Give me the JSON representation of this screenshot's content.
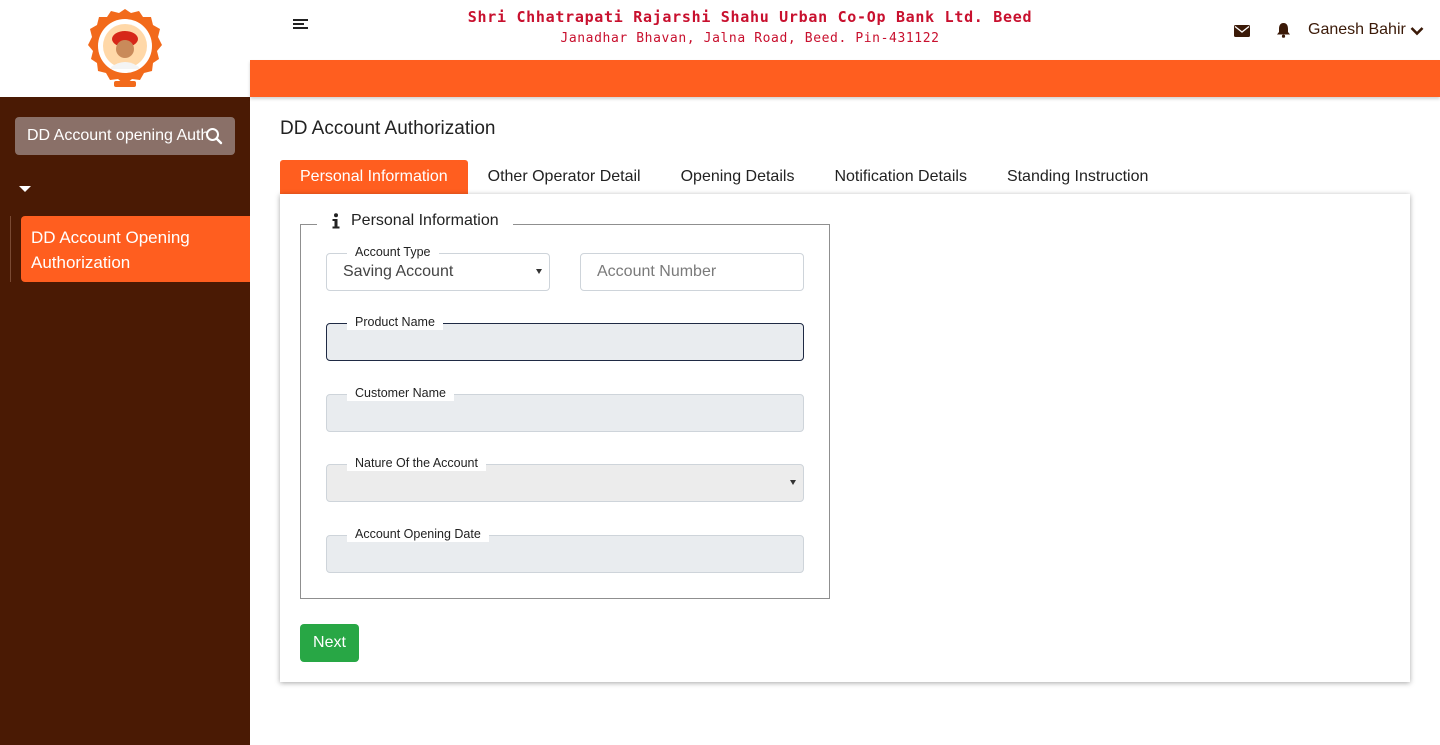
{
  "header": {
    "bank_title": "Shri Chhatrapati Rajarshi Shahu Urban Co-Op Bank Ltd. Beed",
    "bank_address": "Janadhar Bhavan, Jalna Road, Beed. Pin-431122",
    "user_name": "Ganesh Bahir"
  },
  "sidebar": {
    "search_value": "DD Account opening Authorization",
    "items": [
      {
        "label": "DD Account Opening Authorization",
        "active": true
      }
    ]
  },
  "main": {
    "page_title": "DD Account Authorization",
    "tabs": [
      {
        "label": "Personal Information",
        "active": true
      },
      {
        "label": "Other Operator Detail",
        "active": false
      },
      {
        "label": "Opening Details",
        "active": false
      },
      {
        "label": "Notification Details",
        "active": false
      },
      {
        "label": "Standing Instruction",
        "active": false
      }
    ],
    "section_title": "Personal Information",
    "form": {
      "account_type_label": "Account Type",
      "account_type_value": "Saving Account",
      "account_number_placeholder": "Account Number",
      "product_name_label": "Product Name",
      "product_name_value": "",
      "customer_name_label": "Customer Name",
      "customer_name_value": "",
      "nature_label": "Nature Of the Account",
      "nature_value": "",
      "opening_date_label": "Account Opening Date",
      "opening_date_value": ""
    },
    "next_label": "Next"
  },
  "colors": {
    "accent": "#ff5e1f",
    "sidebar_bg": "#4a1a04",
    "title_red": "#c8102e",
    "success": "#28a745"
  },
  "icons": [
    "logo",
    "search-icon",
    "caret-down-icon",
    "hamburger-icon",
    "mail-icon",
    "bell-icon",
    "chevron-down-icon",
    "info-icon",
    "select-arrow-icon"
  ]
}
